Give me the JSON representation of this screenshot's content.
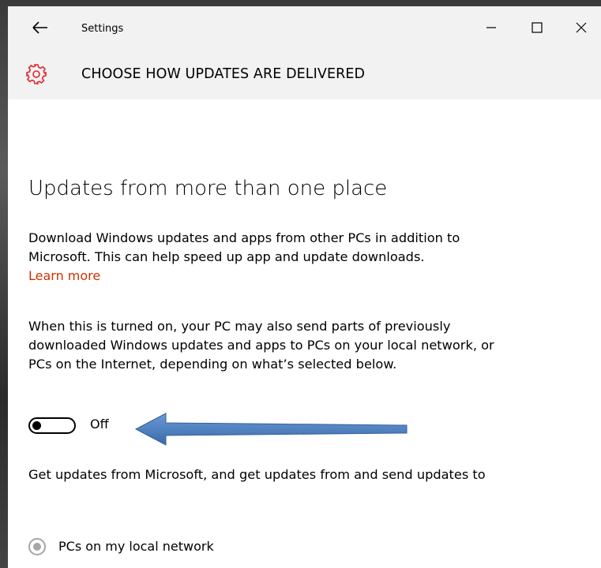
{
  "window": {
    "title": "Settings",
    "page_title": "CHOOSE HOW UPDATES ARE DELIVERED",
    "accent": "#e0262d"
  },
  "content": {
    "section_title": "Updates from more than one place",
    "intro": "Download Windows updates and apps from other PCs in addition to Microsoft. This can help speed up app and update downloads.",
    "learn_more": "Learn more",
    "detail": "When this is turned on, your PC may also send parts of previously downloaded Windows updates and apps to PCs on your local network, or PCs on the Internet, depending on what’s selected below.",
    "toggle": {
      "state": "Off",
      "is_on": false
    },
    "source_prompt": "Get updates from Microsoft, and get updates from and send updates to",
    "radio_option": "PCs on my local network",
    "link_color": "#cc3300"
  },
  "annotation": {
    "arrow_color": "#4a7ebb",
    "arrow_icon": "arrow-left-icon"
  }
}
